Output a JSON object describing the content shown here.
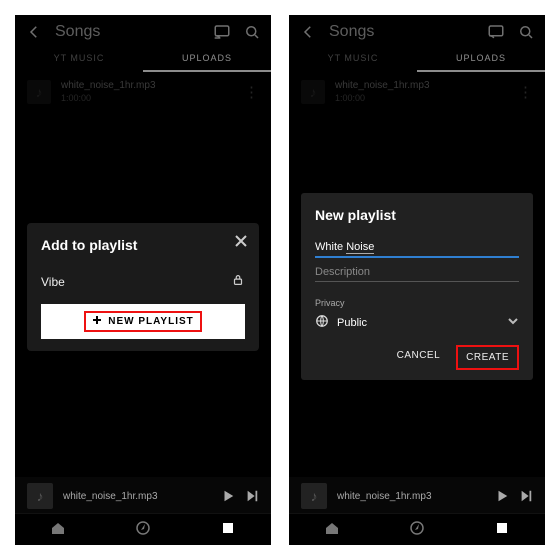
{
  "colors": {
    "highlight": "#e11",
    "accent_blue": "#2f7fd1"
  },
  "header": {
    "title": "Songs"
  },
  "tabs": {
    "left": "YT MUSIC",
    "right": "UPLOADS"
  },
  "song": {
    "title": "white_noise_1hr.mp3",
    "duration": "1:00:00"
  },
  "mini": {
    "title": "white_noise_1hr.mp3"
  },
  "left_sheet": {
    "title": "Add to playlist",
    "existing_playlist": "Vibe",
    "new_button": "NEW PLAYLIST"
  },
  "right_dialog": {
    "title": "New playlist",
    "name_prefix": "White ",
    "name_underlined": "Noise",
    "description_placeholder": "Description",
    "privacy_label": "Privacy",
    "privacy_value": "Public",
    "cancel": "CANCEL",
    "create": "CREATE"
  }
}
